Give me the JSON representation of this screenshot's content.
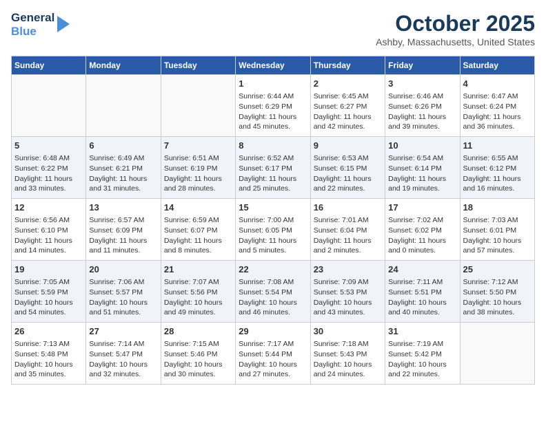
{
  "logo": {
    "line1": "General",
    "line2": "Blue"
  },
  "title": "October 2025",
  "location": "Ashby, Massachusetts, United States",
  "days_of_week": [
    "Sunday",
    "Monday",
    "Tuesday",
    "Wednesday",
    "Thursday",
    "Friday",
    "Saturday"
  ],
  "weeks": [
    [
      {
        "day": "",
        "content": ""
      },
      {
        "day": "",
        "content": ""
      },
      {
        "day": "",
        "content": ""
      },
      {
        "day": "1",
        "content": "Sunrise: 6:44 AM\nSunset: 6:29 PM\nDaylight: 11 hours and 45 minutes."
      },
      {
        "day": "2",
        "content": "Sunrise: 6:45 AM\nSunset: 6:27 PM\nDaylight: 11 hours and 42 minutes."
      },
      {
        "day": "3",
        "content": "Sunrise: 6:46 AM\nSunset: 6:26 PM\nDaylight: 11 hours and 39 minutes."
      },
      {
        "day": "4",
        "content": "Sunrise: 6:47 AM\nSunset: 6:24 PM\nDaylight: 11 hours and 36 minutes."
      }
    ],
    [
      {
        "day": "5",
        "content": "Sunrise: 6:48 AM\nSunset: 6:22 PM\nDaylight: 11 hours and 33 minutes."
      },
      {
        "day": "6",
        "content": "Sunrise: 6:49 AM\nSunset: 6:21 PM\nDaylight: 11 hours and 31 minutes."
      },
      {
        "day": "7",
        "content": "Sunrise: 6:51 AM\nSunset: 6:19 PM\nDaylight: 11 hours and 28 minutes."
      },
      {
        "day": "8",
        "content": "Sunrise: 6:52 AM\nSunset: 6:17 PM\nDaylight: 11 hours and 25 minutes."
      },
      {
        "day": "9",
        "content": "Sunrise: 6:53 AM\nSunset: 6:15 PM\nDaylight: 11 hours and 22 minutes."
      },
      {
        "day": "10",
        "content": "Sunrise: 6:54 AM\nSunset: 6:14 PM\nDaylight: 11 hours and 19 minutes."
      },
      {
        "day": "11",
        "content": "Sunrise: 6:55 AM\nSunset: 6:12 PM\nDaylight: 11 hours and 16 minutes."
      }
    ],
    [
      {
        "day": "12",
        "content": "Sunrise: 6:56 AM\nSunset: 6:10 PM\nDaylight: 11 hours and 14 minutes."
      },
      {
        "day": "13",
        "content": "Sunrise: 6:57 AM\nSunset: 6:09 PM\nDaylight: 11 hours and 11 minutes."
      },
      {
        "day": "14",
        "content": "Sunrise: 6:59 AM\nSunset: 6:07 PM\nDaylight: 11 hours and 8 minutes."
      },
      {
        "day": "15",
        "content": "Sunrise: 7:00 AM\nSunset: 6:05 PM\nDaylight: 11 hours and 5 minutes."
      },
      {
        "day": "16",
        "content": "Sunrise: 7:01 AM\nSunset: 6:04 PM\nDaylight: 11 hours and 2 minutes."
      },
      {
        "day": "17",
        "content": "Sunrise: 7:02 AM\nSunset: 6:02 PM\nDaylight: 11 hours and 0 minutes."
      },
      {
        "day": "18",
        "content": "Sunrise: 7:03 AM\nSunset: 6:01 PM\nDaylight: 10 hours and 57 minutes."
      }
    ],
    [
      {
        "day": "19",
        "content": "Sunrise: 7:05 AM\nSunset: 5:59 PM\nDaylight: 10 hours and 54 minutes."
      },
      {
        "day": "20",
        "content": "Sunrise: 7:06 AM\nSunset: 5:57 PM\nDaylight: 10 hours and 51 minutes."
      },
      {
        "day": "21",
        "content": "Sunrise: 7:07 AM\nSunset: 5:56 PM\nDaylight: 10 hours and 49 minutes."
      },
      {
        "day": "22",
        "content": "Sunrise: 7:08 AM\nSunset: 5:54 PM\nDaylight: 10 hours and 46 minutes."
      },
      {
        "day": "23",
        "content": "Sunrise: 7:09 AM\nSunset: 5:53 PM\nDaylight: 10 hours and 43 minutes."
      },
      {
        "day": "24",
        "content": "Sunrise: 7:11 AM\nSunset: 5:51 PM\nDaylight: 10 hours and 40 minutes."
      },
      {
        "day": "25",
        "content": "Sunrise: 7:12 AM\nSunset: 5:50 PM\nDaylight: 10 hours and 38 minutes."
      }
    ],
    [
      {
        "day": "26",
        "content": "Sunrise: 7:13 AM\nSunset: 5:48 PM\nDaylight: 10 hours and 35 minutes."
      },
      {
        "day": "27",
        "content": "Sunrise: 7:14 AM\nSunset: 5:47 PM\nDaylight: 10 hours and 32 minutes."
      },
      {
        "day": "28",
        "content": "Sunrise: 7:15 AM\nSunset: 5:46 PM\nDaylight: 10 hours and 30 minutes."
      },
      {
        "day": "29",
        "content": "Sunrise: 7:17 AM\nSunset: 5:44 PM\nDaylight: 10 hours and 27 minutes."
      },
      {
        "day": "30",
        "content": "Sunrise: 7:18 AM\nSunset: 5:43 PM\nDaylight: 10 hours and 24 minutes."
      },
      {
        "day": "31",
        "content": "Sunrise: 7:19 AM\nSunset: 5:42 PM\nDaylight: 10 hours and 22 minutes."
      },
      {
        "day": "",
        "content": ""
      }
    ]
  ]
}
